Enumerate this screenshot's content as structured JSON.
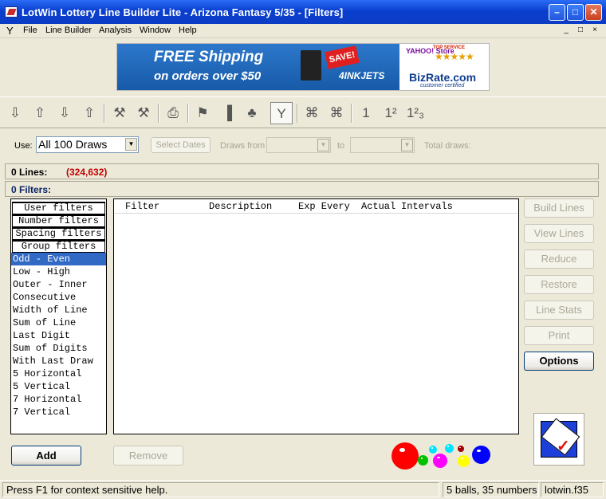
{
  "window": {
    "title": "LotWin Lottery Line Builder Lite - Arizona Fantasy 5/35 - [Filters]",
    "min_glyph": "–",
    "max_glyph": "□",
    "close_glyph": "✕"
  },
  "menu": {
    "logo": "Y",
    "items": [
      "File",
      "Line Builder",
      "Analysis",
      "Window",
      "Help"
    ],
    "mdi": [
      "_",
      "□",
      "×"
    ]
  },
  "banner": {
    "line1": "FREE Shipping",
    "line2": "on orders over $50",
    "badge": "SAVE!",
    "brand": "4INKJETS",
    "yahoo": "YAHOO! Store",
    "top_service": "TOP SERVICE",
    "stars": "★★★★★",
    "bizrate": "BizRate.com",
    "bizrate_sub": "customer certified"
  },
  "toolbar": {
    "icons": [
      "⇩",
      "⇧",
      "⇩",
      "⇧",
      "⚒",
      "⚒",
      "⎙",
      "⚑",
      "▐",
      "♣",
      "Y",
      "⌘",
      "⌘",
      "1",
      "1²",
      "1²₃"
    ]
  },
  "draws": {
    "use_label": "Use:",
    "use_value": "All 100 Draws",
    "select_dates": "Select Dates",
    "draws_from": "Draws from",
    "to": "to",
    "total_draws": "Total draws:"
  },
  "lines": {
    "label": "0 Lines:",
    "value": "(324,632)"
  },
  "filters": {
    "label": "0 Filters:"
  },
  "left_panel": {
    "headers": [
      "User filters",
      "Number filters",
      "Spacing filters",
      "Group filters"
    ],
    "items": [
      "Odd - Even",
      "Low - High",
      "Outer - Inner",
      "Consecutive",
      "Width of Line",
      "Sum of Line",
      "Last Digit",
      "Sum of Digits",
      "With Last Draw",
      "5 Horizontal",
      "5 Vertical",
      "7 Horizontal",
      "7 Vertical"
    ],
    "selected": "Odd - Even"
  },
  "list": {
    "columns": [
      "Filter",
      "Description",
      "Exp Every",
      "Actual",
      "Intervals"
    ]
  },
  "right_buttons": {
    "build": "Build Lines",
    "view": "View Lines",
    "reduce": "Reduce",
    "restore": "Restore",
    "stats": "Line Stats",
    "print": "Print",
    "options": "Options"
  },
  "bottom": {
    "add": "Add",
    "remove": "Remove"
  },
  "status": {
    "help": "Press F1 for context sensitive help.",
    "game": "5 balls, 35 numbers",
    "file": "lotwin.f35"
  },
  "colors": {
    "title_blue": "#0a3fcf",
    "selection": "#316ac5",
    "lines_value": "#c00000",
    "filters_label": "#0a246a",
    "ball_red": "#ff0000",
    "ball_green": "#00c000",
    "ball_magenta": "#ff00ff",
    "ball_cyan": "#00e5ff",
    "ball_yellow": "#ffff00",
    "ball_darkred": "#a00000",
    "ball_blue": "#0000ff"
  }
}
